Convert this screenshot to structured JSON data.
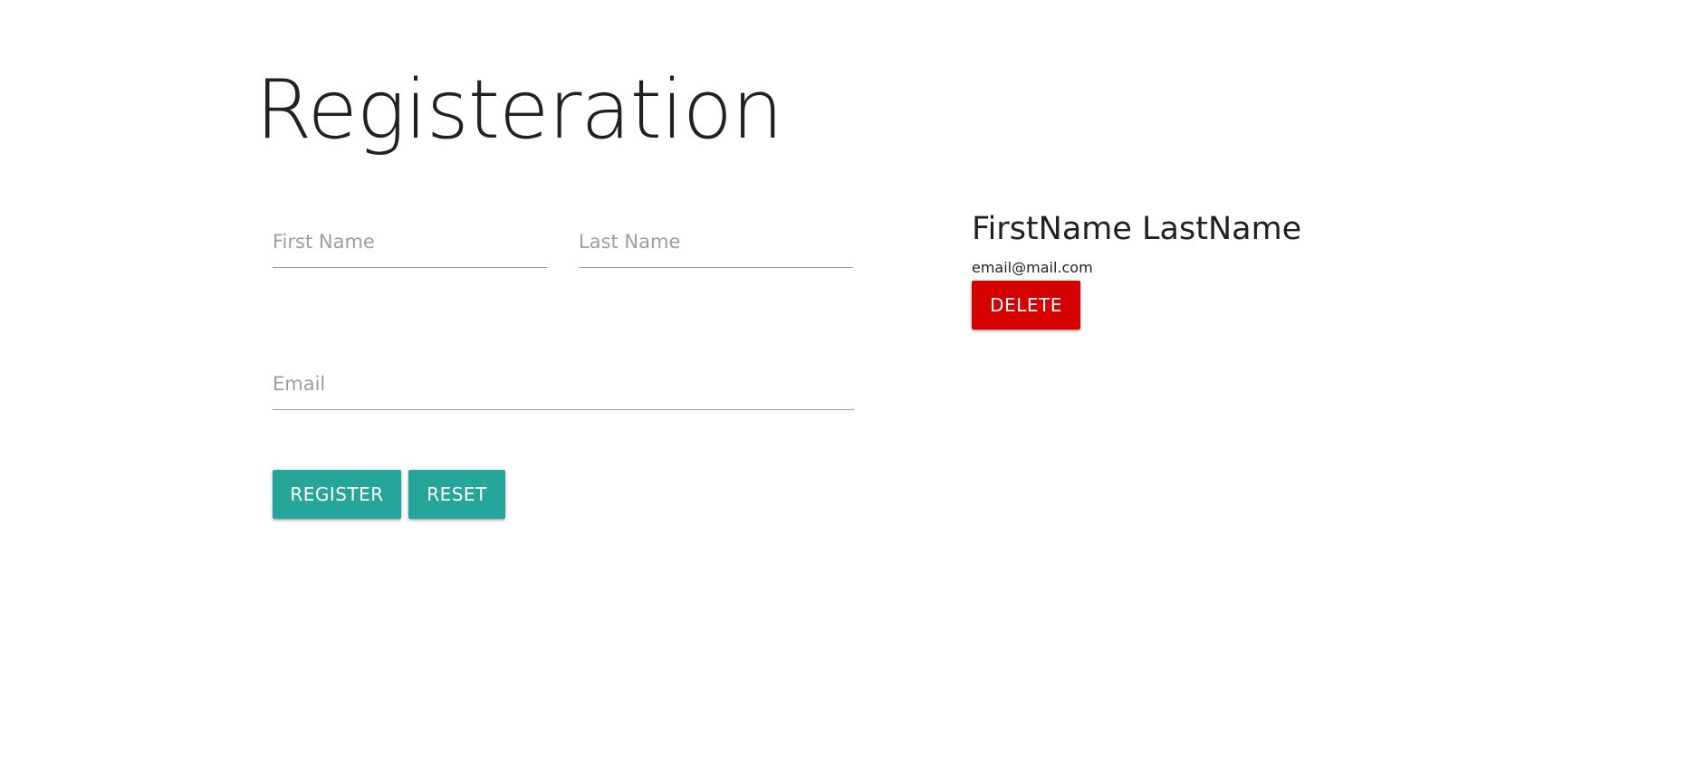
{
  "page": {
    "title": "Registeration"
  },
  "form": {
    "first_name": {
      "value": "",
      "placeholder": "First Name"
    },
    "last_name": {
      "value": "",
      "placeholder": "Last Name"
    },
    "email": {
      "value": "",
      "placeholder": "Email"
    },
    "register_label": "REGISTER",
    "reset_label": "RESET"
  },
  "user_card": {
    "name": "FirstName LastName",
    "email": "email@mail.com",
    "delete_label": "DELETE"
  },
  "colors": {
    "primary_button": "#26a69a",
    "danger_button": "#d50000",
    "text": "#212121",
    "placeholder": "#9e9e9e"
  }
}
